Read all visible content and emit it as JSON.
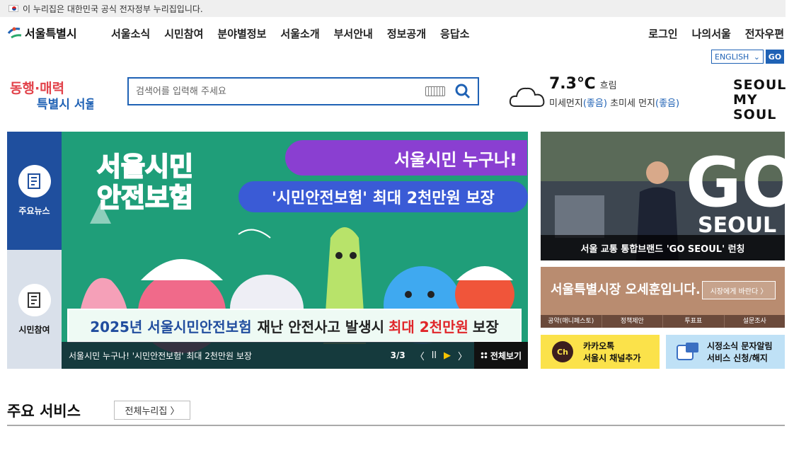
{
  "gov_banner": {
    "text": "이 누리집은 대한민국 공식 전자정부 누리집입니다."
  },
  "logo": {
    "text": "서울특별시"
  },
  "gnb": [
    "서울소식",
    "시민참여",
    "분야별정보",
    "서울소개",
    "부서안내",
    "정보공개",
    "응답소"
  ],
  "util": [
    "로그인",
    "나의서울",
    "전자우편"
  ],
  "language": {
    "selected": "ENGLISH",
    "go": "GO"
  },
  "slogan": {
    "line1": "동행·매력",
    "line2": "특별시 서울"
  },
  "search": {
    "placeholder": "검색어를 입력해 주세요"
  },
  "weather": {
    "temp": "7.3℃",
    "condition": "흐림",
    "dust_label": "미세먼지",
    "dust_value": "(좋음)",
    "fine_dust_label": "초미세 먼지",
    "fine_dust_value": "(좋음)"
  },
  "brand_logo": {
    "line1": "SEOUL",
    "line2": "MY SOUL"
  },
  "side_tabs": [
    {
      "label": "주요뉴스",
      "icon": "news-icon"
    },
    {
      "label": "시민참여",
      "icon": "participation-icon"
    }
  ],
  "main_banner": {
    "title_line1": "서울시민",
    "title_line2": "안전보험",
    "pill_purple": "서울시민 누구나!",
    "pill_blue": "'시민안전보험' 최대 2천만원 보장",
    "strip_part1": "2025년 서울시민안전보험",
    "strip_part2": "재난 안전사고 발생시",
    "strip_hl": "최대 2천만원",
    "strip_part3": "보장",
    "caption": "서울시민 누구나! '시민안전보험' 최대 2천만원 보장",
    "pager": "3/3",
    "view_all": "전체보기"
  },
  "photo_card": {
    "caption": "서울 교통 통합브랜드 'GO SEOUL' 런칭",
    "logo_top": "GO",
    "logo_bottom": "SEOUL"
  },
  "mayor_card": {
    "text": "서울특별시장 오세훈입니다.",
    "button": "시장에게 바란다 〉",
    "links": [
      "공약(매니페스토)",
      "정책제안",
      "투표표",
      "설문조사"
    ]
  },
  "kakao": {
    "icon_text": "Ch",
    "line1": "카카오톡",
    "line2": "서울시 채널추가"
  },
  "sms": {
    "line1": "시정소식 문자알림",
    "line2": "서비스 신청/해지"
  },
  "services": {
    "title": "주요 서비스",
    "all_button": "전체누리집 〉"
  }
}
